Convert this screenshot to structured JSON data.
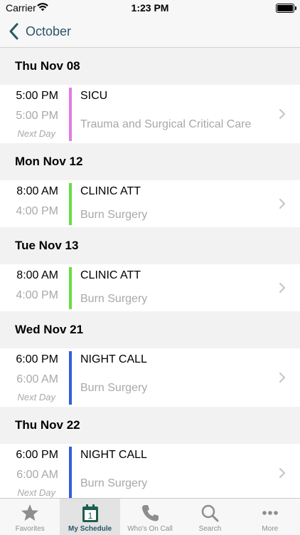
{
  "status": {
    "carrier": "Carrier",
    "time": "1:23 PM"
  },
  "nav": {
    "back_label": "October"
  },
  "sections": [
    {
      "header": "Thu Nov 08",
      "rows": [
        {
          "start": "5:00 PM",
          "end": "5:00 PM",
          "next_day": "Next Day",
          "title": "SICU",
          "subtitle": "Trauma and Surgical Critical Care",
          "color": "#e07ce6"
        }
      ]
    },
    {
      "header": "Mon Nov 12",
      "rows": [
        {
          "start": "8:00 AM",
          "end": "4:00 PM",
          "title": "CLINIC ATT",
          "subtitle": "Burn Surgery",
          "color": "#66dd44"
        }
      ]
    },
    {
      "header": "Tue Nov 13",
      "rows": [
        {
          "start": "8:00 AM",
          "end": "4:00 PM",
          "title": "CLINIC ATT",
          "subtitle": "Burn Surgery",
          "color": "#66dd44"
        }
      ]
    },
    {
      "header": "Wed Nov 21",
      "rows": [
        {
          "start": "6:00 PM",
          "end": "6:00 AM",
          "next_day": "Next Day",
          "title": "NIGHT CALL",
          "subtitle": "Burn Surgery",
          "color": "#2e5fd8"
        }
      ]
    },
    {
      "header": "Thu Nov 22",
      "rows": [
        {
          "start": "6:00 PM",
          "end": "6:00 AM",
          "next_day": "Next Day",
          "title": "NIGHT CALL",
          "subtitle": "Burn Surgery",
          "color": "#2e5fd8"
        }
      ]
    }
  ],
  "tabs": {
    "favorites": {
      "label": "Favorites",
      "icon": "star-icon"
    },
    "my_schedule": {
      "label": "My Schedule",
      "icon": "calendar-icon",
      "day": "1"
    },
    "whos_on_call": {
      "label": "Who's On Call",
      "icon": "phone-icon"
    },
    "search": {
      "label": "Search",
      "icon": "search-icon"
    },
    "more": {
      "label": "More",
      "icon": "more-icon"
    }
  },
  "colors": {
    "accent": "#2a5567",
    "tab_inactive": "#8e8e8e",
    "calendar_green": "#1e5e4e"
  }
}
